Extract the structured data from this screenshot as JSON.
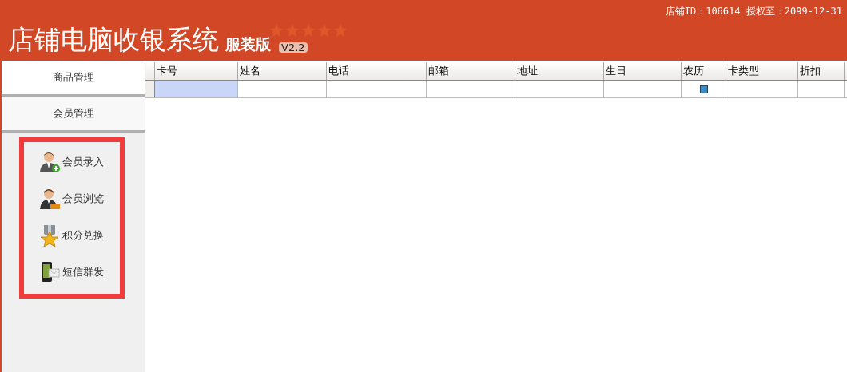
{
  "header": {
    "title": "店铺电脑收银系统",
    "edition": "服装版",
    "version": "V2.2",
    "store_info": "店铺ID：106614 授权至：2099-12-31"
  },
  "sidebar": {
    "sections": [
      {
        "label": "商品管理"
      },
      {
        "label": "会员管理",
        "items": [
          {
            "label": "会员录入"
          },
          {
            "label": "会员浏览"
          },
          {
            "label": "积分兑换"
          },
          {
            "label": "短信群发"
          }
        ]
      }
    ]
  },
  "table": {
    "columns": [
      "卡号",
      "姓名",
      "电话",
      "邮箱",
      "地址",
      "生日",
      "农历",
      "卡类型",
      "折扣"
    ],
    "rows": [
      {
        "cells": [
          {
            "kind": "text",
            "selected": true
          },
          {
            "kind": "text",
            "selected": false
          },
          {
            "kind": "text",
            "selected": false
          },
          {
            "kind": "text",
            "selected": false
          },
          {
            "kind": "text",
            "selected": false
          },
          {
            "kind": "text",
            "selected": false
          },
          {
            "kind": "checkbox",
            "checked": true,
            "selected": false
          },
          {
            "kind": "text",
            "selected": false
          },
          {
            "kind": "text",
            "selected": false
          }
        ]
      }
    ]
  }
}
